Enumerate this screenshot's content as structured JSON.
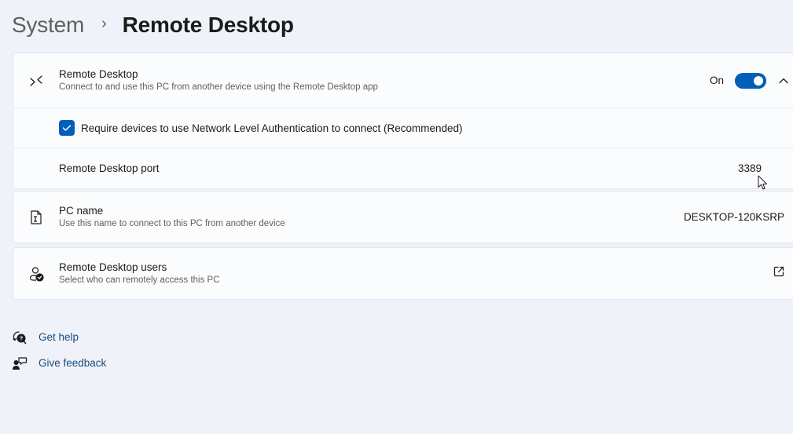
{
  "breadcrumb": {
    "parent": "System",
    "separator": "›",
    "current": "Remote Desktop"
  },
  "remote_desktop_card": {
    "main": {
      "icon": "remote-desktop-icon",
      "title": "Remote Desktop",
      "subtitle": "Connect to and use this PC from another device using the Remote Desktop app",
      "toggle_state_label": "On",
      "toggle_on": true,
      "expanded": true
    },
    "nla_checkbox": {
      "label": "Require devices to use Network Level Authentication to connect (Recommended)",
      "checked": true
    },
    "port": {
      "label": "Remote Desktop port",
      "value": "3389"
    }
  },
  "pc_name_card": {
    "icon": "document-rename-icon",
    "title": "PC name",
    "subtitle": "Use this name to connect to this PC from another device",
    "value": "DESKTOP-120KSRP"
  },
  "users_card": {
    "icon": "user-check-icon",
    "title": "Remote Desktop users",
    "subtitle": "Select who can remotely access this PC",
    "action_icon": "open-external-icon"
  },
  "links": [
    {
      "icon": "get-help-icon",
      "label": "Get help"
    },
    {
      "icon": "give-feedback-icon",
      "label": "Give feedback"
    }
  ],
  "colors": {
    "accent": "#005fb8",
    "background": "#eff3f9",
    "card": "#fbfcfd",
    "link": "#1a4a7a"
  }
}
